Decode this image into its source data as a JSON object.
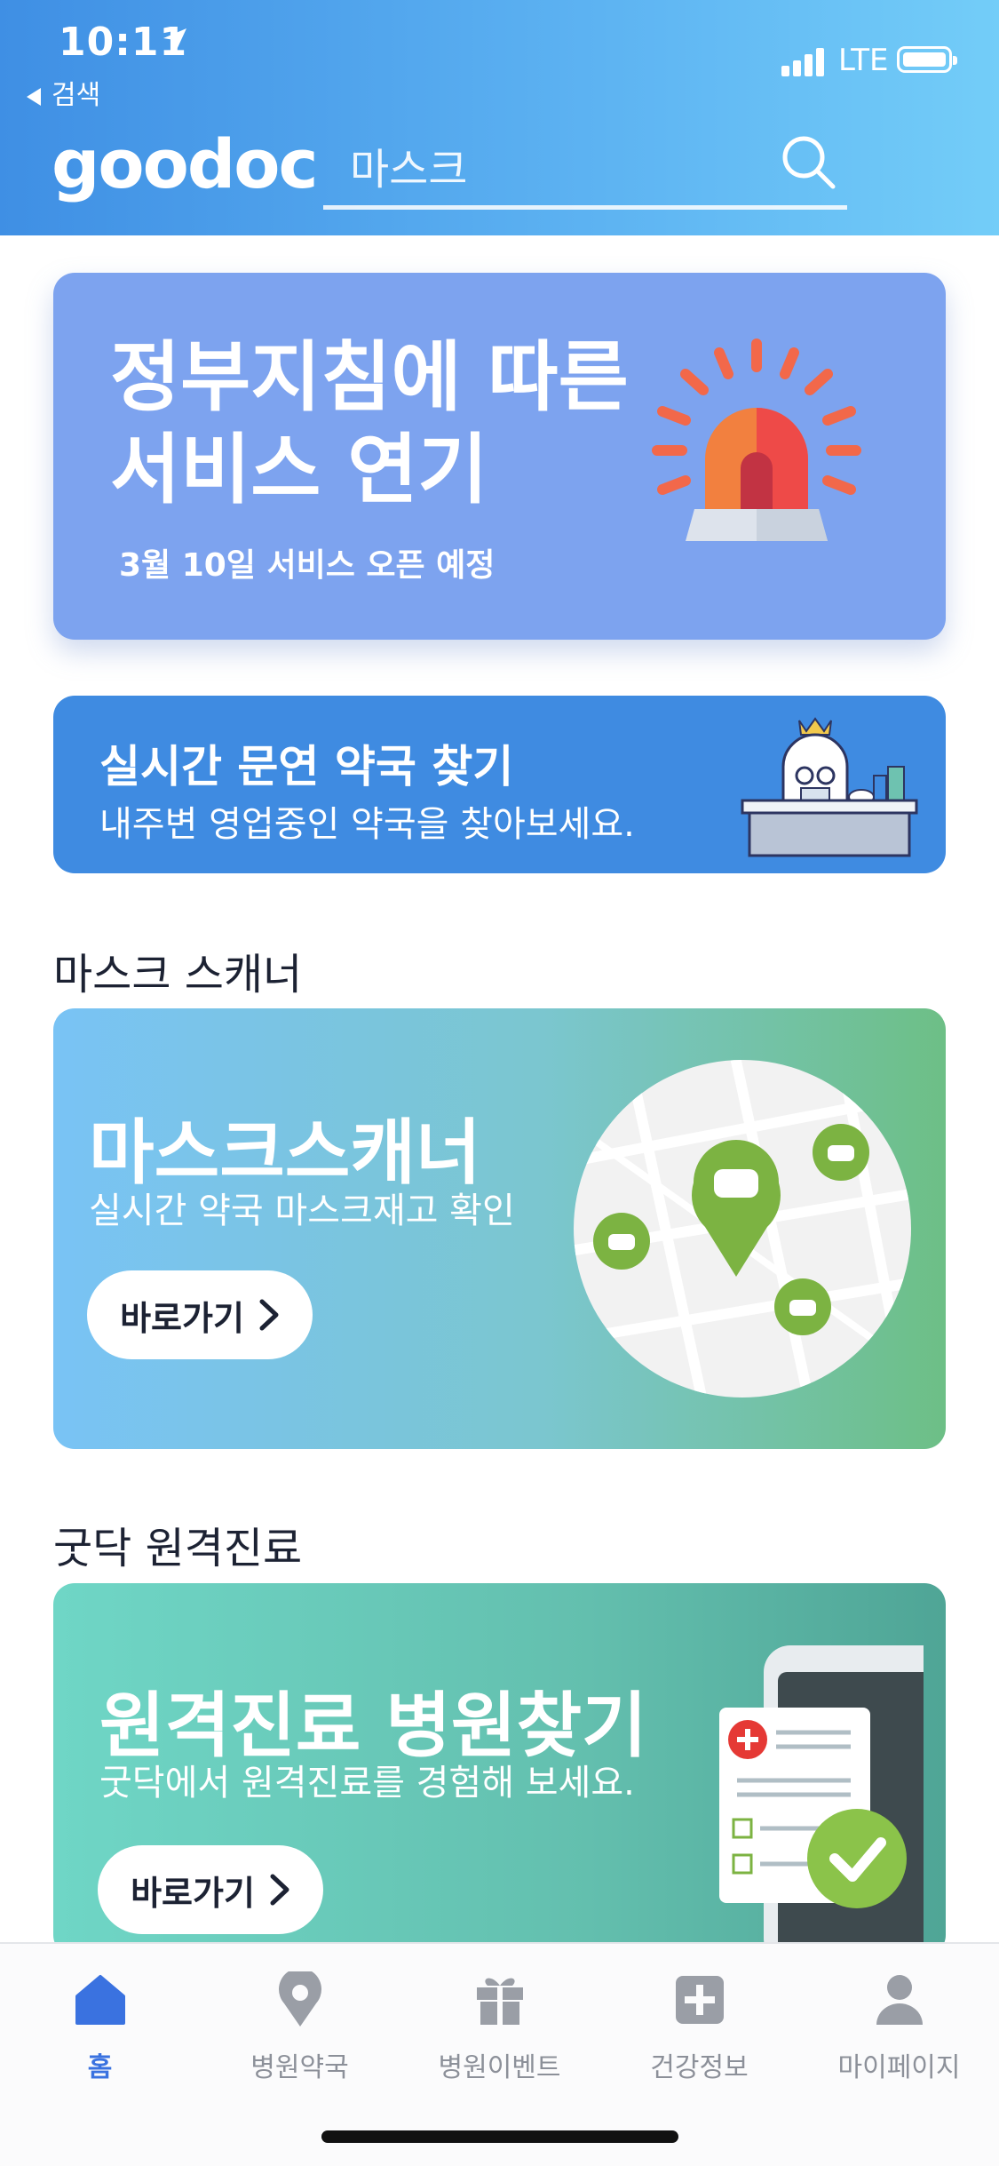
{
  "status_bar": {
    "time": "10:11",
    "back_label": "검색",
    "network": "LTE"
  },
  "header": {
    "logo": "goodoc",
    "search_placeholder": "마스크"
  },
  "notice_banner": {
    "title_line1": "정부지침에 따른",
    "title_line2": "서비스 연기",
    "subtitle": "3월 10일  서비스 오픈 예정"
  },
  "pharmacy_banner": {
    "title": "실시간 문연 약국 찾기",
    "subtitle": "내주변 영업중인 약국을 찾아보세요."
  },
  "mask_section": {
    "heading": "마스크 스캐너",
    "title": "마스크스캐너",
    "subtitle": "실시간 약국 마스크재고 확인",
    "button_label": "바로가기"
  },
  "remote_section": {
    "heading": "굿닥 원격진료",
    "title": "원격진료 병원찾기",
    "subtitle": "굿닥에서 원격진료를 경험해 보세요.",
    "button_label": "바로가기"
  },
  "tabbar": {
    "active_color": "#3a72e0",
    "items": [
      {
        "label": "홈",
        "icon": "home-icon",
        "active": true
      },
      {
        "label": "병원약국",
        "icon": "map-pin-icon",
        "active": false
      },
      {
        "label": "병원이벤트",
        "icon": "gift-icon",
        "active": false
      },
      {
        "label": "건강정보",
        "icon": "medical-cross-icon",
        "active": false
      },
      {
        "label": "마이페이지",
        "icon": "person-icon",
        "active": false
      }
    ]
  }
}
